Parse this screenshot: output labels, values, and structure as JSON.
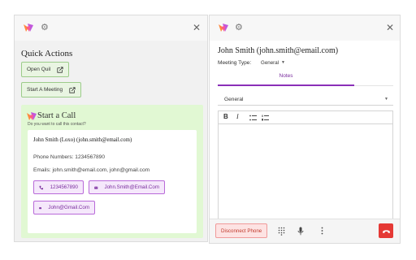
{
  "left_panel": {
    "quick_actions_title": "Quick Actions",
    "open_quil_label": "Open Quil",
    "start_meeting_label": "Start A Meeting",
    "start_call": {
      "title": "Start a Call",
      "subtitle": "Do you want to call this contact?",
      "contact_name": "John Smith (Loxo) (john.smith@email.com)",
      "phone_numbers_line": "Phone Numbers:  1234567890",
      "emails_line": "Emails:  john.smith@email.com, john@gmail.com",
      "phone_button": "1234567890",
      "email_button_1": "John.Smith@Email.Com",
      "email_button_2": "John@Gmail.Com"
    }
  },
  "right_panel": {
    "contact_title": "John Smith (john.smith@email.com)",
    "meeting_type_label": "Meeting Type:",
    "meeting_type_value": "General",
    "tab_notes": "Notes",
    "notes_category": "General",
    "toolbar": {
      "bold": "B",
      "italic": "I"
    },
    "disconnect_label": "Disconnect Phone"
  },
  "colors": {
    "accent_purple": "#8a2fb8",
    "green_bg": "#e1f8d3",
    "danger": "#e53935"
  },
  "icons": [
    "logo-icon",
    "gear-icon",
    "close-icon",
    "external-link-icon",
    "phone-icon",
    "mail-icon",
    "dialpad-icon",
    "microphone-icon",
    "more-vert-icon",
    "hangup-icon",
    "bullet-list-icon",
    "numbered-list-icon",
    "chevron-down-icon"
  ]
}
